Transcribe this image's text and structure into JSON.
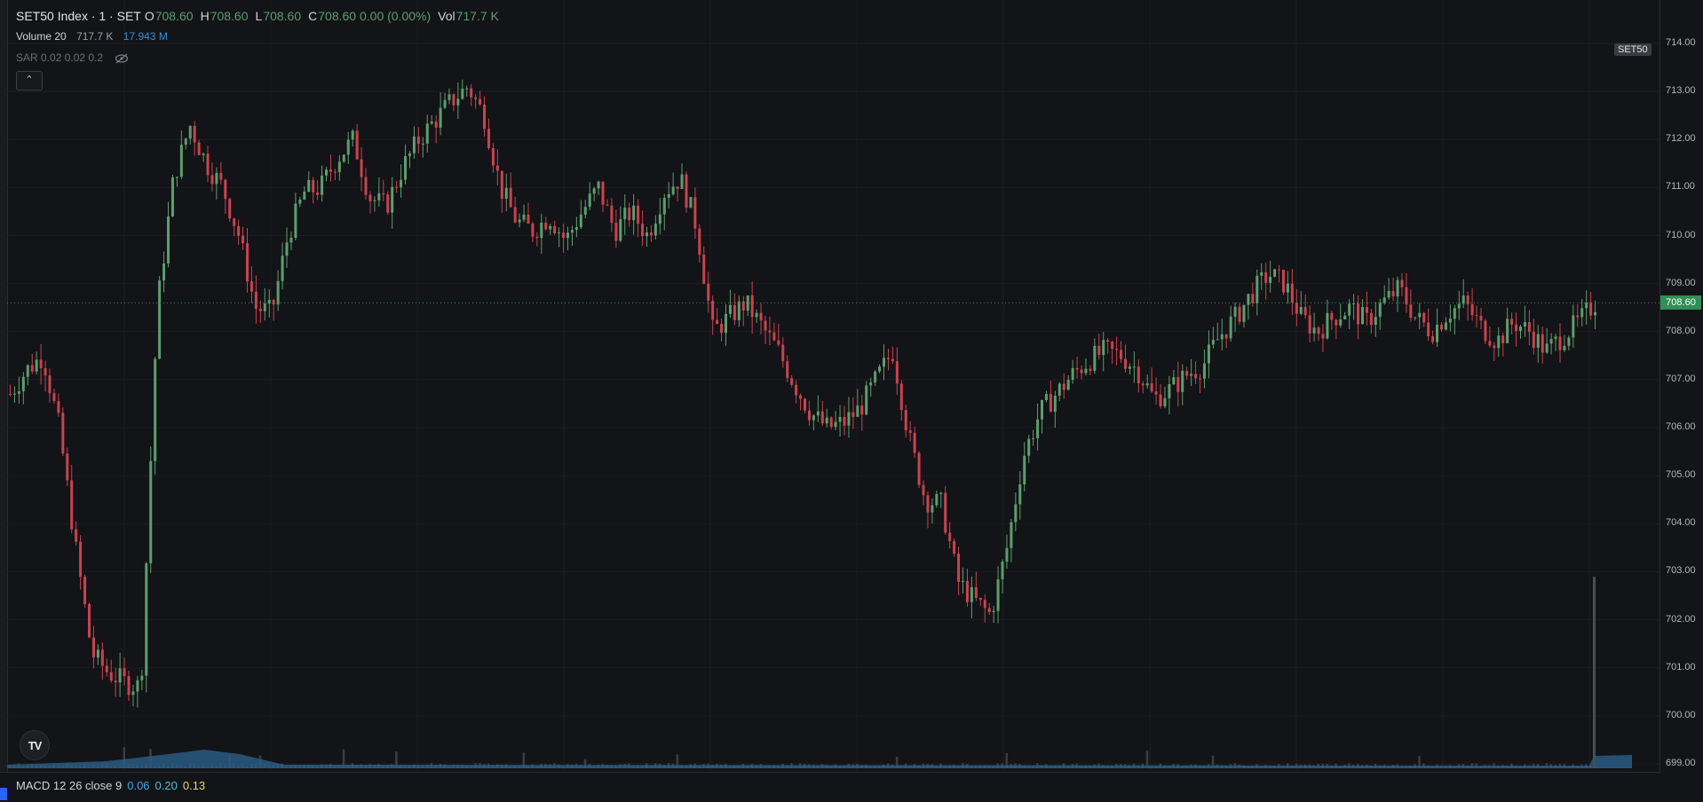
{
  "legend": {
    "symbol": "SET50 Index · 1 · SET",
    "o_label": "O",
    "o_value": "708.60",
    "h_label": "H",
    "h_value": "708.60",
    "l_label": "L",
    "l_value": "708.60",
    "c_label": "C",
    "c_value": "708.60 0.00 (0.00%)",
    "vol_label": "Vol",
    "vol_value": "717.7 K"
  },
  "volume_legend": {
    "label": "Volume 20",
    "value": "717.7 K",
    "ma": "17.943 M"
  },
  "sar_legend": {
    "label": "SAR 0.02 0.02 0.2"
  },
  "collapse_button": {
    "icon": "chevron-up-icon",
    "symbol": "⌃"
  },
  "logo": {
    "text": "TV"
  },
  "macd_legend": {
    "label": "MACD 12 26 close 9",
    "v1": "0.06",
    "v2": "0.20",
    "v3": "0.13"
  },
  "symbol_badge": "SET50",
  "last_price_badge": "708.60",
  "price_axis": [
    "714.00",
    "713.00",
    "712.00",
    "711.00",
    "710.00",
    "709.00",
    "708.00",
    "707.00",
    "706.00",
    "705.00",
    "704.00",
    "703.00",
    "702.00",
    "701.00",
    "700.00",
    "699.00"
  ],
  "colors": {
    "up": "#5d9e6e",
    "down": "#c9434f",
    "volume": "#2c5f8a",
    "background": "#131417",
    "last_price": "#2f8f55"
  },
  "chart_data": {
    "type": "candlestick",
    "symbol": "SET50",
    "interval": "1",
    "ylim": [
      699,
      714
    ],
    "last_price": 708.6,
    "series": [
      {
        "name": "price_path",
        "values": [
          706.7,
          707.2,
          707.5,
          706.0,
          703.5,
          701.3,
          700.9,
          700.7,
          700.6,
          708.5,
          711.2,
          712.3,
          711.5,
          711.0,
          710.0,
          708.5,
          708.4,
          710.0,
          710.9,
          711.0,
          711.6,
          712.0,
          710.8,
          710.6,
          711.4,
          712.0,
          712.4,
          712.8,
          713.1,
          712.5,
          711.0,
          710.3,
          710.1,
          710.4,
          709.9,
          710.5,
          711.0,
          710.1,
          710.5,
          710.0,
          710.9,
          711.2,
          710.2,
          708.0,
          708.3,
          708.6,
          708.1,
          707.6,
          706.9,
          706.3,
          706.0,
          706.1,
          706.4,
          707.0,
          707.6,
          705.8,
          704.5,
          704.4,
          702.8,
          702.4,
          702.1,
          703.5,
          705.4,
          706.3,
          706.7,
          707.1,
          707.4,
          707.6,
          707.5,
          707.2,
          706.6,
          706.8,
          707.1,
          707.3,
          707.9,
          708.3,
          708.8,
          709.2,
          709.0,
          708.3,
          708.0,
          708.3,
          708.5,
          708.2,
          708.6,
          708.9,
          708.3,
          708.0,
          708.4,
          708.6,
          708.1,
          707.8,
          708.2,
          708.0,
          707.6,
          707.9,
          708.2,
          708.6
        ]
      }
    ],
    "volume": {
      "base_bars": "low uniform",
      "spikes_at_end": true,
      "volume_ma": 17.943
    }
  }
}
